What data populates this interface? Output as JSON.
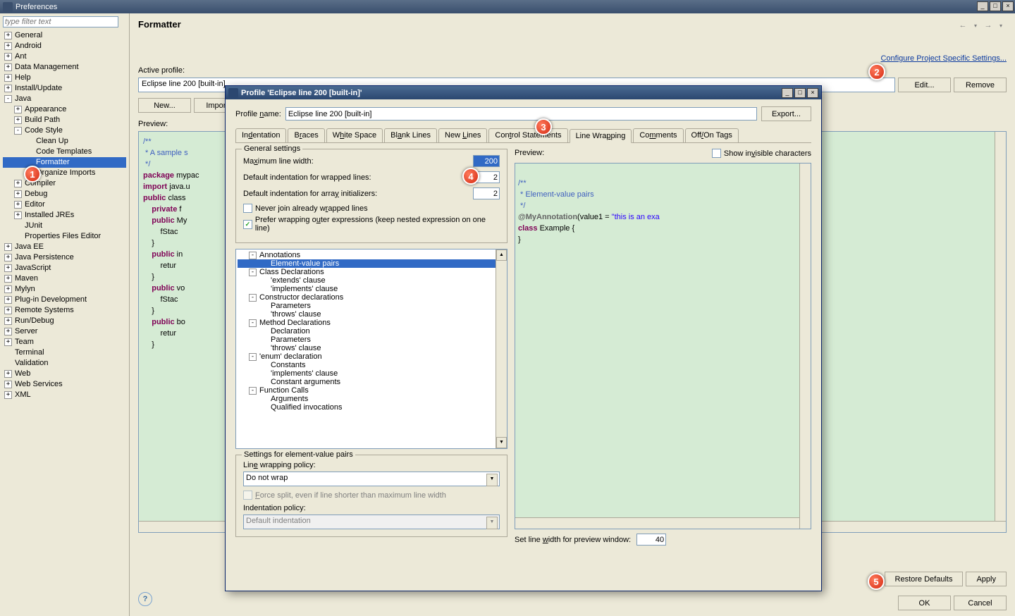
{
  "prefs": {
    "window_title": "Preferences",
    "filter_placeholder": "type filter text",
    "tree": [
      {
        "label": "General",
        "exp": "plus"
      },
      {
        "label": "Android",
        "exp": "plus"
      },
      {
        "label": "Ant",
        "exp": "plus"
      },
      {
        "label": "Data Management",
        "exp": "plus"
      },
      {
        "label": "Help",
        "exp": "plus"
      },
      {
        "label": "Install/Update",
        "exp": "plus"
      },
      {
        "label": "Java",
        "exp": "minus",
        "children": [
          {
            "label": "Appearance",
            "exp": "plus"
          },
          {
            "label": "Build Path",
            "exp": "plus"
          },
          {
            "label": "Code Style",
            "exp": "minus",
            "children": [
              {
                "label": "Clean Up"
              },
              {
                "label": "Code Templates"
              },
              {
                "label": "Formatter",
                "selected": true
              },
              {
                "label": "Organize Imports"
              }
            ]
          },
          {
            "label": "Compiler",
            "exp": "plus"
          },
          {
            "label": "Debug",
            "exp": "plus"
          },
          {
            "label": "Editor",
            "exp": "plus"
          },
          {
            "label": "Installed JREs",
            "exp": "plus"
          },
          {
            "label": "JUnit"
          },
          {
            "label": "Properties Files Editor"
          }
        ]
      },
      {
        "label": "Java EE",
        "exp": "plus"
      },
      {
        "label": "Java Persistence",
        "exp": "plus"
      },
      {
        "label": "JavaScript",
        "exp": "plus"
      },
      {
        "label": "Maven",
        "exp": "plus"
      },
      {
        "label": "Mylyn",
        "exp": "plus"
      },
      {
        "label": "Plug-in Development",
        "exp": "plus"
      },
      {
        "label": "Remote Systems",
        "exp": "plus"
      },
      {
        "label": "Run/Debug",
        "exp": "plus"
      },
      {
        "label": "Server",
        "exp": "plus"
      },
      {
        "label": "Team",
        "exp": "plus"
      },
      {
        "label": "Terminal"
      },
      {
        "label": "Validation"
      },
      {
        "label": "Web",
        "exp": "plus"
      },
      {
        "label": "Web Services",
        "exp": "plus"
      },
      {
        "label": "XML",
        "exp": "plus"
      }
    ],
    "heading": "Formatter",
    "configure_link": "Configure Project Specific Settings...",
    "active_profile_label": "Active profile:",
    "active_profile_value": "Eclipse line 200 [built-in]",
    "edit_btn": "Edit...",
    "remove_btn": "Remove",
    "new_btn": "New...",
    "import_btn": "Import...",
    "preview_label": "Preview:",
    "restore_btn": "Restore Defaults",
    "apply_btn": "Apply",
    "ok_btn": "OK",
    "cancel_btn": "Cancel",
    "code_lines": [
      "/**",
      " * A sample s",
      " */",
      "",
      "package mypac",
      "",
      "import java.u",
      "",
      "public class ",
      "    private f",
      "",
      "    public My",
      "        fStac",
      "    }",
      "",
      "    public in",
      "        retur",
      "    }",
      "",
      "    public vo",
      "        fStac",
      "    }",
      "",
      "    public bo",
      "        retur",
      "    }"
    ]
  },
  "dialog": {
    "title": "Profile 'Eclipse line 200 [built-in]'",
    "name_label": "Profile name:",
    "name_value": "Eclipse line 200 [built-in]",
    "export_btn": "Export...",
    "tabs": [
      "Indentation",
      "Braces",
      "White Space",
      "Blank Lines",
      "New Lines",
      "Control Statements",
      "Line Wrapping",
      "Comments",
      "Off/On Tags"
    ],
    "active_tab": "Line Wrapping",
    "general_legend": "General settings",
    "max_line_label": "Maximum line width:",
    "max_line_value": "200",
    "indent_wrapped_label": "Default indentation for wrapped lines:",
    "indent_wrapped_value": "2",
    "indent_array_label": "Default indentation for array initializers:",
    "indent_array_value": "2",
    "never_join_label": "Never join already wrapped lines",
    "prefer_outer_label": "Prefer wrapping outer expressions (keep nested expression on one line)",
    "tree_items": [
      {
        "label": "Annotations",
        "exp": "minus",
        "ind": 1
      },
      {
        "label": "Element-value pairs",
        "ind": 2,
        "selected": true
      },
      {
        "label": "Class Declarations",
        "exp": "minus",
        "ind": 1
      },
      {
        "label": "'extends' clause",
        "ind": 2
      },
      {
        "label": "'implements' clause",
        "ind": 2
      },
      {
        "label": "Constructor declarations",
        "exp": "minus",
        "ind": 1
      },
      {
        "label": "Parameters",
        "ind": 2
      },
      {
        "label": "'throws' clause",
        "ind": 2
      },
      {
        "label": "Method Declarations",
        "exp": "minus",
        "ind": 1
      },
      {
        "label": "Declaration",
        "ind": 2
      },
      {
        "label": "Parameters",
        "ind": 2
      },
      {
        "label": "'throws' clause",
        "ind": 2
      },
      {
        "label": "'enum' declaration",
        "exp": "minus",
        "ind": 1
      },
      {
        "label": "Constants",
        "ind": 2
      },
      {
        "label": "'implements' clause",
        "ind": 2
      },
      {
        "label": "Constant arguments",
        "ind": 2
      },
      {
        "label": "Function Calls",
        "exp": "minus",
        "ind": 1
      },
      {
        "label": "Arguments",
        "ind": 2
      },
      {
        "label": "Qualified invocations",
        "ind": 2
      }
    ],
    "settings_legend": "Settings for element-value pairs",
    "wrap_policy_label": "Line wrapping policy:",
    "wrap_policy_value": "Do not wrap",
    "force_split_label": "Force split, even if line shorter than maximum line width",
    "indent_policy_label": "Indentation policy:",
    "indent_policy_value": "Default indentation",
    "preview_label": "Preview:",
    "show_invisible_label": "Show invisible characters",
    "set_width_label": "Set line width for preview window:",
    "set_width_value": "40",
    "code_preview": {
      "l1": "/**",
      "l2": " * Element-value pairs",
      "l3": " */",
      "l4_at": "@MyAnnotation",
      "l4_paren": "(value1 = ",
      "l4_str": "\"this is an exa",
      "l5_kw": "class",
      "l5_rest": " Example {",
      "l6": "}"
    }
  },
  "annotations": {
    "a1": "1",
    "a2": "2",
    "a3": "3",
    "a4": "4",
    "a5": "5"
  }
}
